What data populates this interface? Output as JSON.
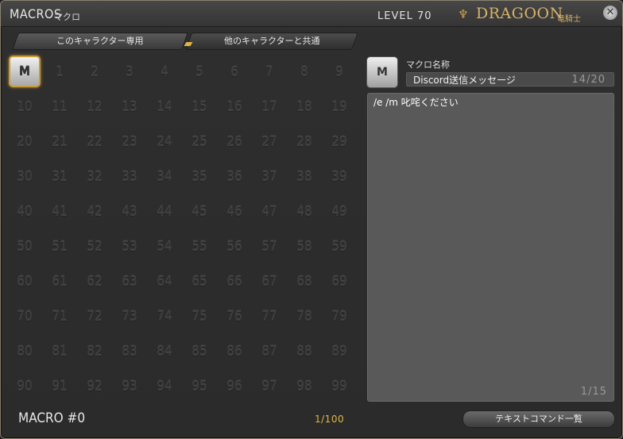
{
  "title": {
    "en": "MACROS",
    "jp": "マクロ"
  },
  "level_label": "LEVEL 70",
  "job": {
    "name": "DRAGOON",
    "jp": "竜騎士",
    "icon": "dragoon-job-icon"
  },
  "tabs": [
    {
      "label": "このキャラクター専用",
      "active": true
    },
    {
      "label": "他のキャラクターと共通",
      "active": false
    }
  ],
  "grid": {
    "selected_index": 0,
    "selected_icon_letter": "M",
    "numbers": [
      "",
      "1",
      "2",
      "3",
      "4",
      "5",
      "6",
      "7",
      "8",
      "9",
      "10",
      "11",
      "12",
      "13",
      "14",
      "15",
      "16",
      "17",
      "18",
      "19",
      "20",
      "21",
      "22",
      "23",
      "24",
      "25",
      "26",
      "27",
      "28",
      "29",
      "30",
      "31",
      "32",
      "33",
      "34",
      "35",
      "36",
      "37",
      "38",
      "39",
      "40",
      "41",
      "42",
      "43",
      "44",
      "45",
      "46",
      "47",
      "48",
      "49",
      "50",
      "51",
      "52",
      "53",
      "54",
      "55",
      "56",
      "57",
      "58",
      "59",
      "60",
      "61",
      "62",
      "63",
      "64",
      "65",
      "66",
      "67",
      "68",
      "69",
      "70",
      "71",
      "72",
      "73",
      "74",
      "75",
      "76",
      "77",
      "78",
      "79",
      "80",
      "81",
      "82",
      "83",
      "84",
      "85",
      "86",
      "87",
      "88",
      "89",
      "90",
      "91",
      "92",
      "93",
      "94",
      "95",
      "96",
      "97",
      "98",
      "99"
    ]
  },
  "editor": {
    "icon_letter": "M",
    "name_label": "マクロ名称",
    "name_value": "Discord送信メッセージ",
    "name_count": "14/20",
    "text": "/e /m 叱咤ください",
    "line_count": "1/15"
  },
  "footer": {
    "macro_label": "MACRO #0",
    "count": "1/100",
    "command_button": "テキストコマンド一覧"
  }
}
